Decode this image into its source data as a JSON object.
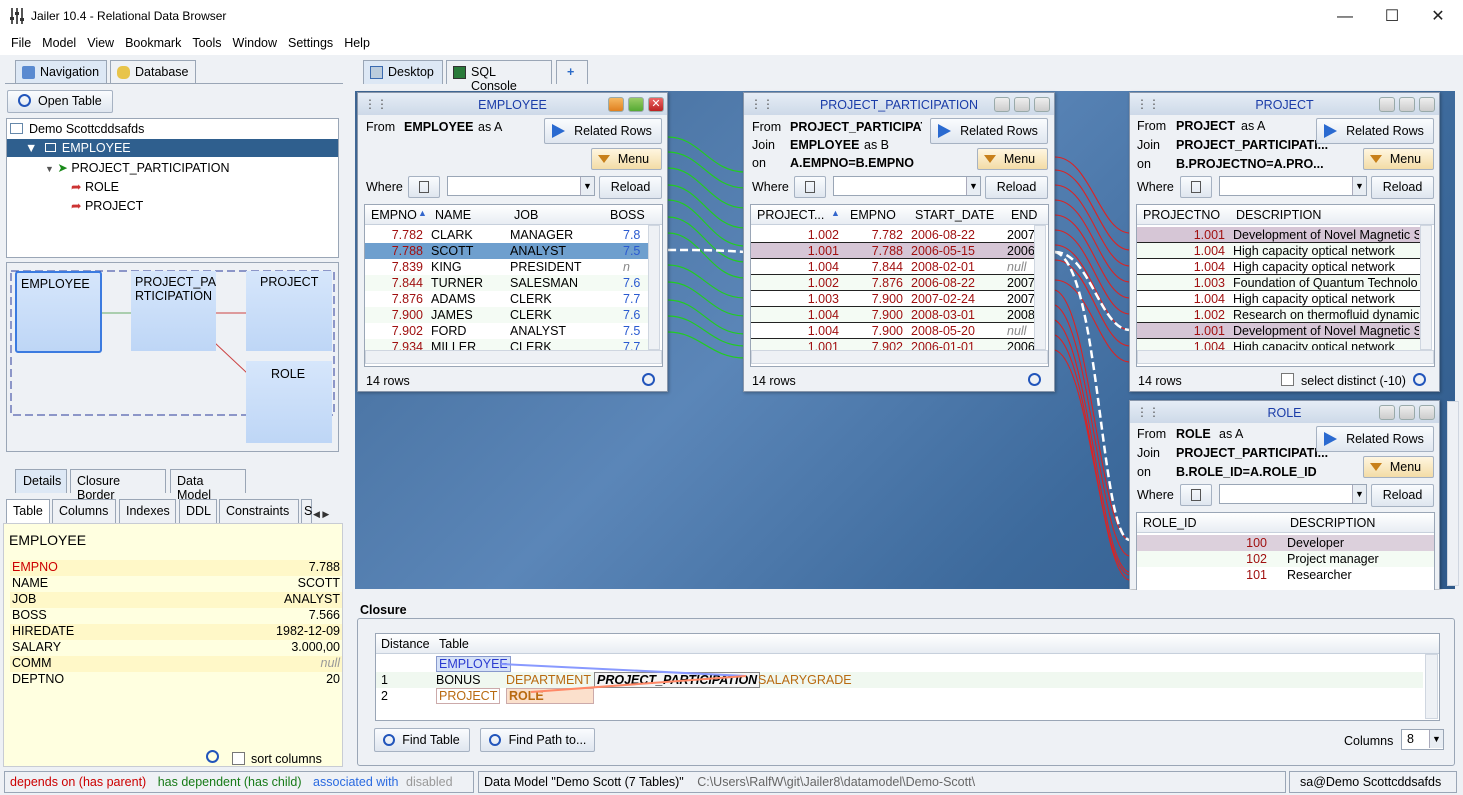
{
  "app": {
    "title": "Jailer 10.4 - Relational Data Browser"
  },
  "menu": [
    "File",
    "Model",
    "View",
    "Bookmark",
    "Tools",
    "Window",
    "Settings",
    "Help"
  ],
  "left_tabs": [
    "Navigation",
    "Database"
  ],
  "open_table": "Open Table",
  "tree": {
    "root": "Demo Scottcddsafds",
    "items": [
      "EMPLOYEE",
      "PROJECT_PARTICIPATION",
      "ROLE",
      "PROJECT"
    ]
  },
  "overview": {
    "boxes": [
      "EMPLOYEE",
      "PROJECT_PA\nRTICIPATION",
      "PROJECT",
      "ROLE"
    ]
  },
  "detail_tabs": [
    "Details",
    "Closure Border",
    "Data Model"
  ],
  "sub_tabs": [
    "Table",
    "Columns",
    "Indexes",
    "DDL",
    "Constraints",
    "S"
  ],
  "details": {
    "table": "EMPLOYEE",
    "rows": [
      [
        "EMPNO",
        "7.788"
      ],
      [
        "NAME",
        "SCOTT"
      ],
      [
        "JOB",
        "ANALYST"
      ],
      [
        "BOSS",
        "7.566"
      ],
      [
        "HIREDATE",
        "1982-12-09"
      ],
      [
        "SALARY",
        "3.000,00"
      ],
      [
        "COMM",
        "null"
      ],
      [
        "DEPTNO",
        "20"
      ]
    ],
    "sort_columns": "sort columns"
  },
  "main_tabs": [
    "Desktop",
    "SQL Console"
  ],
  "labels": {
    "from": "From",
    "join": "Join",
    "on": "on",
    "where": "Where",
    "as_a": "as A",
    "as_b": "as B",
    "related_rows": "Related Rows",
    "menu": "Menu",
    "reload": "Reload",
    "select_distinct": "select distinct (-10)"
  },
  "employee": {
    "title": "EMPLOYEE",
    "from": "EMPLOYEE",
    "columns": [
      "EMPNO",
      "NAME",
      "JOB",
      "BOSS"
    ],
    "rows": [
      [
        "7.782",
        "CLARK",
        "MANAGER",
        "7.8"
      ],
      [
        "7.788",
        "SCOTT",
        "ANALYST",
        "7.5"
      ],
      [
        "7.839",
        "KING",
        "PRESIDENT",
        "n"
      ],
      [
        "7.844",
        "TURNER",
        "SALESMAN",
        "7.6"
      ],
      [
        "7.876",
        "ADAMS",
        "CLERK",
        "7.7"
      ],
      [
        "7.900",
        "JAMES",
        "CLERK",
        "7.6"
      ],
      [
        "7.902",
        "FORD",
        "ANALYST",
        "7.5"
      ],
      [
        "7.934",
        "MILLER",
        "CLERK",
        "7.7"
      ]
    ],
    "count": "14 rows"
  },
  "pp": {
    "title": "PROJECT_PARTICIPATION",
    "from": "PROJECT_PARTICIPAT",
    "join": "EMPLOYEE",
    "on": "A.EMPNO=B.EMPNO",
    "columns": [
      "PROJECT...",
      "EMPNO",
      "START_DATE",
      "END"
    ],
    "rows": [
      [
        "1.002",
        "7.782",
        "2006-08-22",
        "2007"
      ],
      [
        "1.001",
        "7.788",
        "2006-05-15",
        "2006"
      ],
      [
        "1.004",
        "7.844",
        "2008-02-01",
        "null"
      ],
      [
        "1.002",
        "7.876",
        "2006-08-22",
        "2007"
      ],
      [
        "1.003",
        "7.900",
        "2007-02-24",
        "2007"
      ],
      [
        "1.004",
        "7.900",
        "2008-03-01",
        "2008"
      ],
      [
        "1.004",
        "7.900",
        "2008-05-20",
        "null"
      ],
      [
        "1.001",
        "7.902",
        "2006-01-01",
        "2006"
      ]
    ],
    "count": "14 rows"
  },
  "project": {
    "title": "PROJECT",
    "from": "PROJECT",
    "join": "PROJECT_PARTICIPATI...",
    "on": "B.PROJECTNO=A.PRO...",
    "columns": [
      "PROJECTNO",
      "DESCRIPTION"
    ],
    "rows": [
      [
        "1.001",
        "Development of Novel Magnetic S"
      ],
      [
        "1.004",
        "High capacity optical network"
      ],
      [
        "1.004",
        "High capacity optical network"
      ],
      [
        "1.003",
        "Foundation of Quantum Technolo"
      ],
      [
        "1.004",
        "High capacity optical network"
      ],
      [
        "1.002",
        "Research on thermofluid dynamic"
      ],
      [
        "1.001",
        "Development of Novel Magnetic S"
      ],
      [
        "1.004",
        "High capacity optical network"
      ]
    ],
    "count": "14 rows"
  },
  "role": {
    "title": "ROLE",
    "from": "ROLE",
    "join": "PROJECT_PARTICIPATI...",
    "on": "B.ROLE_ID=A.ROLE_ID",
    "columns": [
      "ROLE_ID",
      "DESCRIPTION"
    ],
    "rows": [
      [
        "100",
        "Developer"
      ],
      [
        "102",
        "Project manager"
      ],
      [
        "101",
        "Researcher"
      ]
    ]
  },
  "closure": {
    "title": "Closure",
    "columns": [
      "Distance",
      "Table"
    ],
    "rows": [
      [
        "",
        "EMPLOYEE",
        "",
        "",
        ""
      ],
      [
        "1",
        "BONUS",
        "DEPARTMENT",
        "PROJECT_PARTICIPATION",
        "SALARYGRADE"
      ],
      [
        "2",
        "PROJECT",
        "ROLE",
        "",
        ""
      ]
    ],
    "find_table": "Find Table",
    "find_path": "Find Path to...",
    "columns_label": "Columns",
    "columns_value": "8"
  },
  "status": {
    "depends": "depends on (has parent)",
    "dependent": "has dependent (has child)",
    "associated": "associated with",
    "disabled": "disabled",
    "model": "Data Model \"Demo Scott (7 Tables)\"",
    "path": "C:\\Users\\RalfW\\git\\Jailer8\\datamodel\\Demo-Scott\\",
    "user": "sa@Demo Scottcddsafds"
  }
}
